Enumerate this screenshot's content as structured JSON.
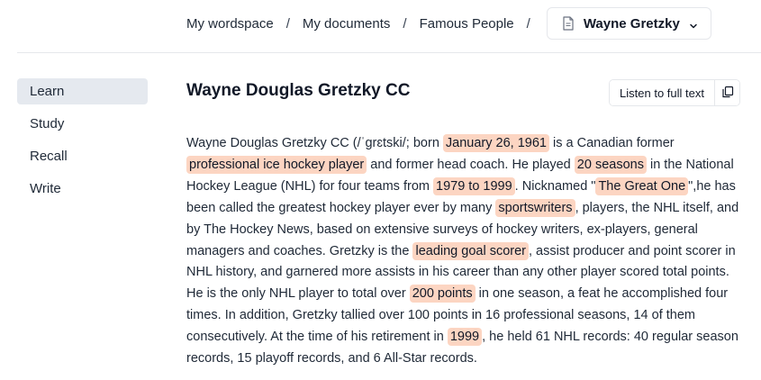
{
  "breadcrumb": {
    "items": [
      "My wordspace",
      "My documents",
      "Famous People"
    ],
    "separator": "/",
    "current_document": "Wayne Gretzky"
  },
  "sidebar": {
    "items": [
      {
        "label": "Learn",
        "active": true
      },
      {
        "label": "Study",
        "active": false
      },
      {
        "label": "Recall",
        "active": false
      },
      {
        "label": "Write",
        "active": false
      }
    ]
  },
  "document": {
    "heading": "Wayne Douglas Gretzky CC",
    "listen_label": "Listen to full text",
    "segments": [
      {
        "text": "Wayne Douglas Gretzky CC (/ˈɡrɛtski/; born "
      },
      {
        "text": "January 26, 1961",
        "highlight": true
      },
      {
        "text": " is a Canadian former "
      },
      {
        "text": "professional ice hockey player",
        "highlight": true
      },
      {
        "text": " and former head coach. He played "
      },
      {
        "text": "20 seasons",
        "highlight": true
      },
      {
        "text": " in the National Hockey League (NHL) for four teams from "
      },
      {
        "text": "1979 to 1999",
        "highlight": true
      },
      {
        "text": ". Nicknamed \""
      },
      {
        "text": "The Great One",
        "highlight": true
      },
      {
        "text": "\",he has been called the greatest hockey player ever by many "
      },
      {
        "text": "sportswriters",
        "highlight": true
      },
      {
        "text": ", players, the NHL itself, and by The Hockey News, based on extensive surveys of hockey writers, ex-players, general managers and coaches. Gretzky is the "
      },
      {
        "text": "leading goal scorer",
        "highlight": true
      },
      {
        "text": ", assist producer and point scorer in NHL history, and garnered more assists in his career than any other player scored total points. He is the only NHL player to total over "
      },
      {
        "text": "200 points",
        "highlight": true
      },
      {
        "text": " in one season, a feat he accomplished four times. In addition, Gretzky tallied over 100 points in 16 professional seasons, 14 of them consecutively. At the time of his retirement in "
      },
      {
        "text": "1999",
        "highlight": true
      },
      {
        "text": ", he held 61 NHL records: 40 regular season records, 15 playoff records, and 6 All-Star records."
      }
    ]
  },
  "colors": {
    "highlight": "#fcd5c2",
    "active_sidebar": "#e5e9ef",
    "border": "#e5e7eb",
    "text": "#1f2937"
  },
  "icons": {
    "document": "document-icon",
    "dropdown": "chevron-down-icon",
    "copy": "copy-icon"
  }
}
